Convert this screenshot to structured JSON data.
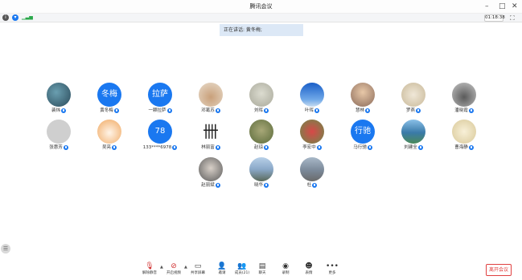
{
  "window": {
    "title": "腾讯会议"
  },
  "infobar": {
    "timer": "01:18:38"
  },
  "speaking": {
    "label": "正在讲话: 黄冬梅;"
  },
  "participants": [
    {
      "name": "裴炜",
      "avatar_text": ""
    },
    {
      "name": "黄冬梅",
      "avatar_text": "冬梅"
    },
    {
      "name": "一颗拉萨",
      "avatar_text": "拉萨"
    },
    {
      "name": "邓葛苏",
      "avatar_text": ""
    },
    {
      "name": "刘晖",
      "avatar_text": ""
    },
    {
      "name": "叶晖",
      "avatar_text": ""
    },
    {
      "name": "慧林",
      "avatar_text": ""
    },
    {
      "name": "罗燕",
      "avatar_text": ""
    },
    {
      "name": "潘晓霞",
      "avatar_text": ""
    },
    {
      "name": "张惠芳",
      "avatar_text": ""
    },
    {
      "name": "吴亮",
      "avatar_text": ""
    },
    {
      "name": "133****6978",
      "avatar_text": "78"
    },
    {
      "name": "林丽富",
      "avatar_text": ""
    },
    {
      "name": "赵琼",
      "avatar_text": ""
    },
    {
      "name": "李宏中",
      "avatar_text": ""
    },
    {
      "name": "马行驰",
      "avatar_text": "行驰"
    },
    {
      "name": "刘建全",
      "avatar_text": ""
    },
    {
      "name": "曹海静",
      "avatar_text": ""
    },
    {
      "name": "赵丽斌",
      "avatar_text": ""
    },
    {
      "name": "晓华",
      "avatar_text": ""
    },
    {
      "name": "杜",
      "avatar_text": ""
    }
  ],
  "toolbar": {
    "buttons": [
      {
        "label": "解除静音",
        "icon": "microphone-muted-icon"
      },
      {
        "label": "开启视频",
        "icon": "camera-off-icon"
      },
      {
        "label": "共享屏幕",
        "icon": "share-screen-icon"
      },
      {
        "label": "邀请",
        "icon": "invite-icon"
      },
      {
        "label": "成员(21)",
        "icon": "members-icon"
      },
      {
        "label": "聊天",
        "icon": "chat-icon"
      },
      {
        "label": "录制",
        "icon": "record-icon"
      },
      {
        "label": "表情",
        "icon": "emoji-icon"
      },
      {
        "label": "更多",
        "icon": "more-icon"
      }
    ],
    "leave_label": "离开会议"
  }
}
